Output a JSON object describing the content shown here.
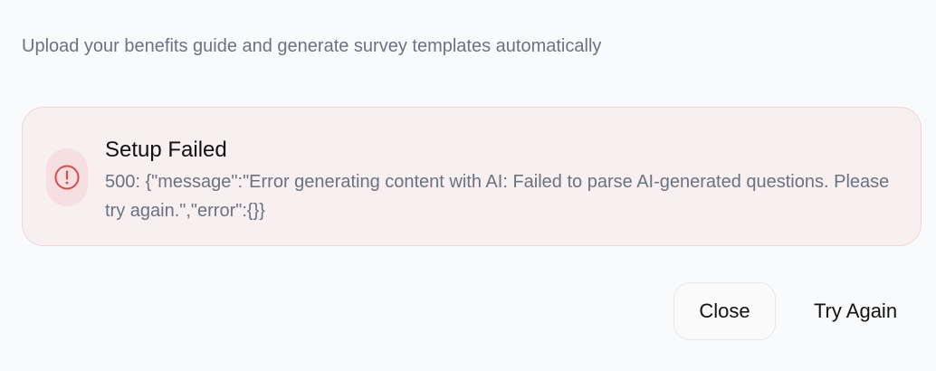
{
  "header": {
    "subtitle": "Upload your benefits guide and generate survey templates automatically"
  },
  "error": {
    "icon": "alert-circle-icon",
    "title": "Setup Failed",
    "message": "500: {\"message\":\"Error generating content with AI: Failed to parse AI-generated questions. Please try again.\",\"error\":{}}"
  },
  "actions": {
    "close_label": "Close",
    "retry_label": "Try Again"
  },
  "colors": {
    "error_accent": "#dc4a4a",
    "error_background": "#f7eff0",
    "error_border": "#f2d4d8",
    "muted_text": "#6b7280"
  }
}
